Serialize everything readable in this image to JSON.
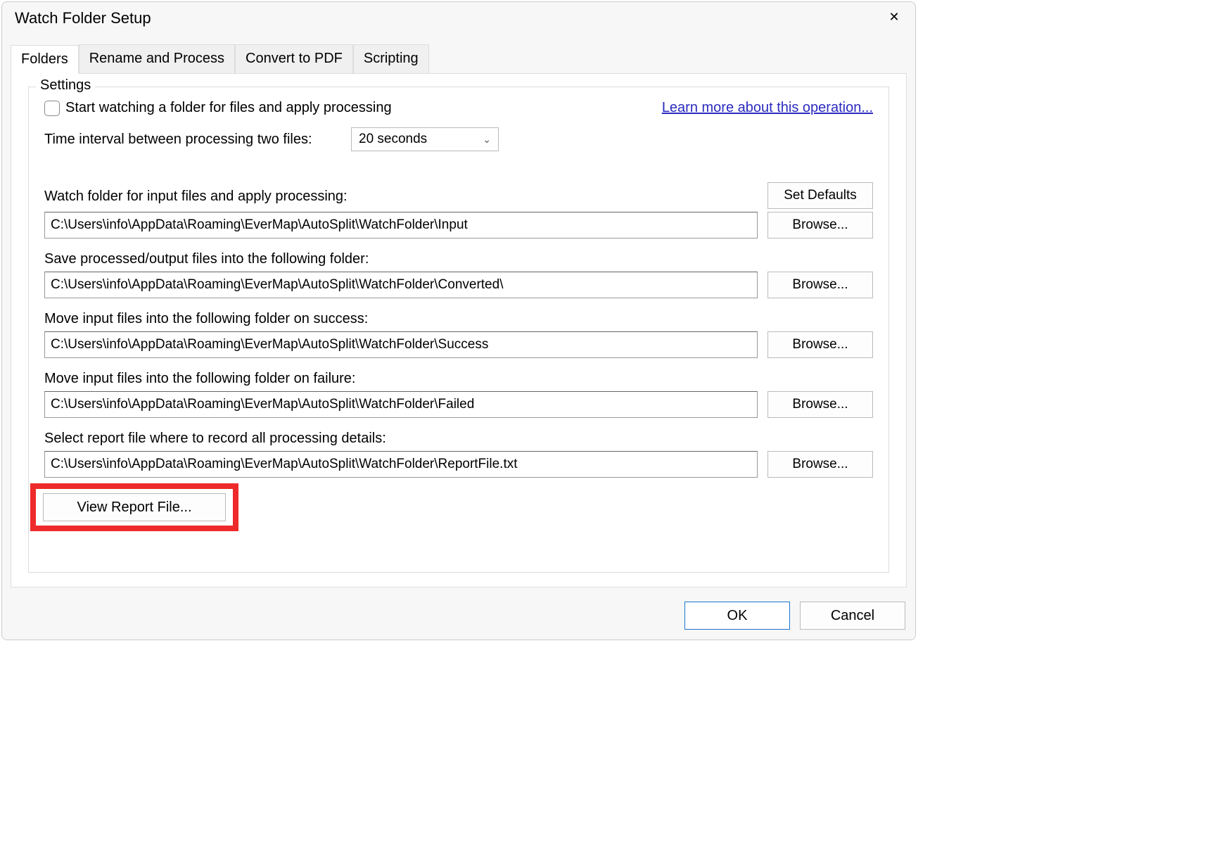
{
  "dialog": {
    "title": "Watch Folder Setup"
  },
  "tabs": [
    {
      "label": "Folders"
    },
    {
      "label": "Rename and Process"
    },
    {
      "label": "Convert to PDF"
    },
    {
      "label": "Scripting"
    }
  ],
  "group": {
    "legend": "Settings",
    "start_watch_label": "Start watching a folder for files and apply processing",
    "learn_more": "Learn more about this operation...",
    "interval_label": "Time interval between processing two files:",
    "interval_value": "20 seconds",
    "set_defaults": "Set Defaults",
    "fields": [
      {
        "label": "Watch folder for input files and apply processing:",
        "value": "C:\\Users\\info\\AppData\\Roaming\\EverMap\\AutoSplit\\WatchFolder\\Input",
        "browse": "Browse..."
      },
      {
        "label": "Save processed/output files into the following folder:",
        "value": "C:\\Users\\info\\AppData\\Roaming\\EverMap\\AutoSplit\\WatchFolder\\Converted\\",
        "browse": "Browse..."
      },
      {
        "label": "Move input files into the following folder on success:",
        "value": "C:\\Users\\info\\AppData\\Roaming\\EverMap\\AutoSplit\\WatchFolder\\Success",
        "browse": "Browse..."
      },
      {
        "label": "Move input files into the following folder on failure:",
        "value": "C:\\Users\\info\\AppData\\Roaming\\EverMap\\AutoSplit\\WatchFolder\\Failed",
        "browse": "Browse..."
      },
      {
        "label": "Select report file where to record all processing details:",
        "value": "C:\\Users\\info\\AppData\\Roaming\\EverMap\\AutoSplit\\WatchFolder\\ReportFile.txt",
        "browse": "Browse..."
      }
    ],
    "view_report": "View Report File..."
  },
  "buttons": {
    "ok": "OK",
    "cancel": "Cancel"
  }
}
